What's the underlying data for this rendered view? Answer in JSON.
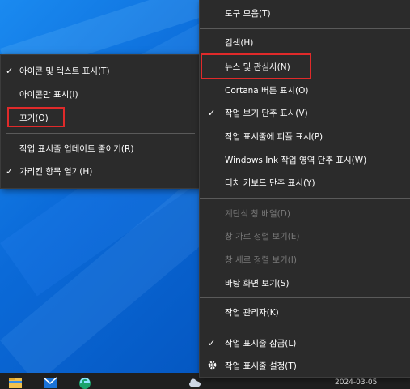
{
  "taskbar": {
    "clock": "2024-03-05",
    "apps": [
      "folder-icon",
      "mail-icon",
      "edge-icon"
    ]
  },
  "left_menu": {
    "items": [
      {
        "label": "아이콘 및 텍스트 표시(T)",
        "checked": true
      },
      {
        "label": "아이콘만 표시(I)",
        "checked": false
      },
      {
        "label": "끄기(O)",
        "checked": false,
        "highlighted": true
      },
      {
        "label": "작업 표시줄 업데이트 줄이기(R)",
        "checked": false
      },
      {
        "label": "가리킨 항목 열기(H)",
        "checked": true
      }
    ]
  },
  "right_menu": {
    "items": [
      {
        "label": "도구 모음(T)"
      },
      {
        "label": "검색(H)"
      },
      {
        "label": "뉴스 및 관심사(N)",
        "highlighted": true
      },
      {
        "label": "Cortana 버튼 표시(O)"
      },
      {
        "label": "작업 보기 단추 표시(V)",
        "checked": true
      },
      {
        "label": "작업 표시줄에 피플 표시(P)"
      },
      {
        "label": "Windows Ink 작업 영역 단추 표시(W)"
      },
      {
        "label": "터치 키보드 단추 표시(Y)"
      },
      {
        "label": "계단식 창 배열(D)",
        "disabled": true
      },
      {
        "label": "창 가로 정렬 보기(E)",
        "disabled": true
      },
      {
        "label": "창 세로 정렬 보기(I)",
        "disabled": true
      },
      {
        "label": "바탕 화면 보기(S)"
      },
      {
        "label": "작업 관리자(K)"
      },
      {
        "label": "작업 표시줄 잠금(L)",
        "checked": true
      },
      {
        "label": "작업 표시줄 설정(T)",
        "icon": "gear-icon"
      }
    ]
  },
  "colors": {
    "menu_bg": "#2b2b2b",
    "highlight_box": "#e02a2a",
    "desktop": "#0b6ad8",
    "taskbar": "#1f1f1f"
  }
}
